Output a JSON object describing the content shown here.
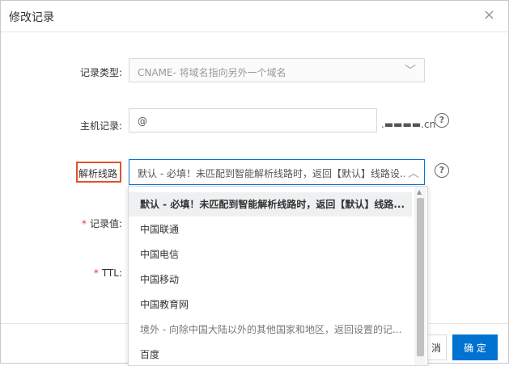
{
  "dialog": {
    "title": "修改记录",
    "close_icon": "×"
  },
  "form": {
    "record_type": {
      "label": "记录类型:",
      "value": "CNAME- 将域名指向另外一个域名"
    },
    "host_record": {
      "label": "主机记录:",
      "value": "@",
      "suffix": ".▬▬▬▬.cn"
    },
    "resolution_line": {
      "label": "解析线路",
      "value": "默认 - 必填！未匹配到智能解析线路时，返回【默认】线路设..."
    },
    "record_value": {
      "required_mark": "*",
      "label": "记录值:"
    },
    "ttl": {
      "required_mark": "*",
      "label": "TTL:"
    },
    "help_icon": "?"
  },
  "dropdown": {
    "options": [
      "默认 - 必填！未匹配到智能解析线路时，返回【默认】线路...",
      "中国联通",
      "中国电信",
      "中国移动",
      "中国教育网",
      "境外 - 向除中国大陆以外的其他国家和地区，返回设置的记...",
      "百度"
    ],
    "selected_index": 0
  },
  "footer": {
    "cancel_label": "消",
    "confirm_label": "确 定"
  },
  "colors": {
    "primary": "#0073d1",
    "highlight_box": "#e4502a",
    "required": "#e4393c"
  }
}
